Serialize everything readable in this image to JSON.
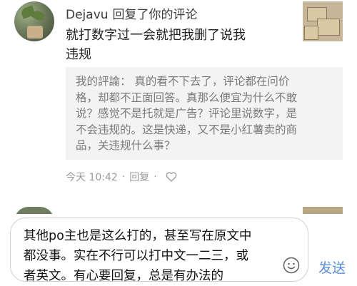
{
  "comment": {
    "username": "Dejavu",
    "action": "回复了你的评论",
    "reply_lines": [
      "就打数字过一会就把我删了说我",
      "违规"
    ],
    "quote_lines": [
      "我的評論： 真的看不下去了，评论都在问价",
      "格，却都不正面回答。真那么便宜为什么不敢",
      "说？感觉不是托就是广告？评论里说数字，是",
      "不会违规的。这是快递，又不是小红薯卖的商",
      "品，关违规什么事？"
    ],
    "time": "今天 10:42",
    "separator": "·",
    "reply_action": "回复",
    "like_icon": "heart-outline-icon"
  },
  "composer": {
    "text_lines": [
      "其他po主也是这么打的，甚至写在原文中",
      "都没事。实在不行可以打中文一二三，或",
      "者英文。有心要回复，总是有办法的"
    ],
    "emoji_icon": "smiley-icon",
    "send_label": "发送",
    "send_color": "#5b8fd6"
  }
}
